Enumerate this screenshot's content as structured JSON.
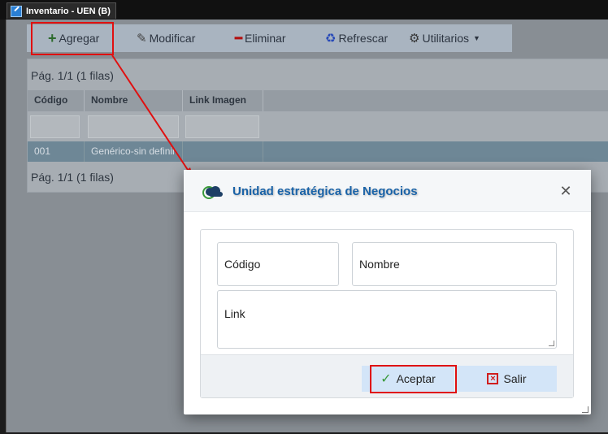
{
  "window": {
    "title": "Inventario - UEN (B)",
    "icon": "edit-document-icon"
  },
  "toolbar": {
    "add_label": "Agregar",
    "edit_label": "Modificar",
    "delete_label": "Eliminar",
    "refresh_label": "Refrescar",
    "utilities_label": "Utilitarios"
  },
  "grid": {
    "pager_top": "Pág. 1/1 (1 filas)",
    "pager_bottom": "Pág. 1/1 (1 filas)",
    "columns": [
      "Código",
      "Nombre",
      "Link Imagen"
    ],
    "rows": [
      {
        "codigo": "001",
        "nombre": "Genérico-sin definir",
        "link": ""
      }
    ]
  },
  "modal": {
    "title": "Unidad estratégica de Negocios",
    "fields": {
      "codigo_placeholder": "Código",
      "nombre_placeholder": "Nombre",
      "link_placeholder": "Link"
    },
    "accept_label": "Aceptar",
    "exit_label": "Salir"
  },
  "colors": {
    "highlight": "#e01010",
    "modal_title": "#1a63a8"
  }
}
